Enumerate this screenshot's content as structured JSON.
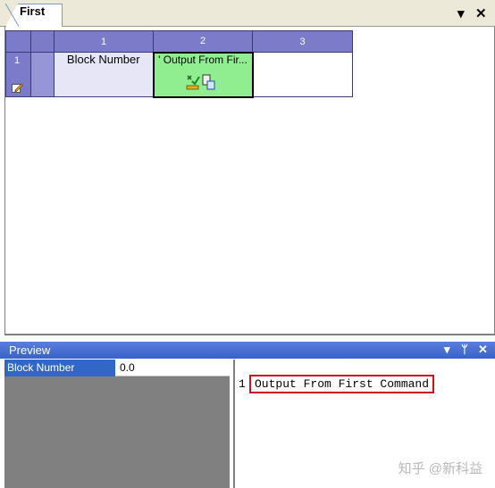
{
  "document": {
    "tab_title": "First",
    "dropdown_glyph": "▾",
    "close_glyph": "✕"
  },
  "grid": {
    "column_headers": [
      "1",
      "2",
      "3"
    ],
    "rows": [
      {
        "number": "1",
        "cells": [
          "Block Number",
          "' Output From Fir...",
          ""
        ]
      }
    ]
  },
  "preview": {
    "title": "Preview",
    "dropdown_glyph": "▾",
    "pin_glyph": "ᛘ",
    "close_glyph": "✕",
    "properties": [
      {
        "name": "Block Number",
        "value": "0.0"
      }
    ],
    "code_lines": [
      {
        "number": "1",
        "text": "Output From First Command"
      }
    ]
  },
  "watermark": "知乎 @新科益",
  "colors": {
    "header_purple": "#7b7bc9",
    "command_cell_green": "#90ee90",
    "preview_bar_blue": "#3863c9",
    "highlight_red": "#d0101e"
  }
}
